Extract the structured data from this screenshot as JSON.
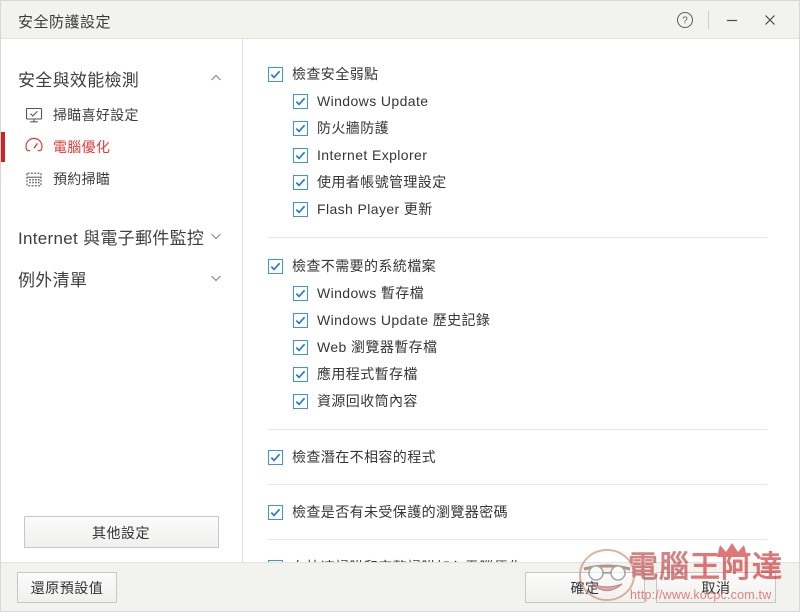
{
  "window": {
    "title": "安全防護設定",
    "controls": [
      {
        "name": "help-button",
        "glyph": "?"
      },
      {
        "name": "minimize-button",
        "glyph": "−"
      },
      {
        "name": "close-button",
        "glyph": "×"
      }
    ]
  },
  "sidebar": {
    "sections": [
      {
        "label": "安全與效能檢測",
        "expanded": true,
        "chevron": "chevron-up-icon",
        "items": [
          {
            "label": "掃瞄喜好設定",
            "icon": "monitor-check-icon",
            "active": false
          },
          {
            "label": "電腦優化",
            "icon": "gauge-icon",
            "active": true
          },
          {
            "label": "預約掃瞄",
            "icon": "calendar-icon",
            "active": false
          }
        ]
      },
      {
        "label": "Internet 與電子郵件監控",
        "expanded": false,
        "chevron": "chevron-down-icon",
        "items": []
      },
      {
        "label": "例外清單",
        "expanded": false,
        "chevron": "chevron-down-icon",
        "items": []
      }
    ],
    "other_settings_label": "其他設定"
  },
  "main": {
    "groups": [
      {
        "parent": {
          "label": "檢查安全弱點",
          "checked": true
        },
        "children": [
          {
            "label": "Windows Update",
            "checked": true
          },
          {
            "label": "防火牆防護",
            "checked": true
          },
          {
            "label": "Internet Explorer",
            "checked": true
          },
          {
            "label": "使用者帳號管理設定",
            "checked": true
          },
          {
            "label": "Flash Player 更新",
            "checked": true
          }
        ]
      },
      {
        "parent": {
          "label": "檢查不需要的系統檔案",
          "checked": true
        },
        "children": [
          {
            "label": "Windows 暫存檔",
            "checked": true
          },
          {
            "label": "Windows Update 歷史記錄",
            "checked": true
          },
          {
            "label": "Web 瀏覽器暫存檔",
            "checked": true
          },
          {
            "label": "應用程式暫存檔",
            "checked": true
          },
          {
            "label": "資源回收筒內容",
            "checked": true
          }
        ]
      },
      {
        "parent": {
          "label": "檢查潛在不相容的程式",
          "checked": true
        },
        "children": []
      },
      {
        "parent": {
          "label": "檢查是否有未受保護的瀏覽器密碼",
          "checked": true
        },
        "children": []
      },
      {
        "parent": {
          "label": "在快速掃瞄和完整掃瞄加入電腦優化",
          "checked": true
        },
        "children": []
      }
    ]
  },
  "footer": {
    "restore_label": "還原預設值",
    "ok_label": "確定",
    "cancel_label": "取消"
  },
  "watermark": {
    "text_part1": "電腦",
    "text_part2": "王阿達",
    "url": "http://www.kocpc.com.tw"
  },
  "colors": {
    "accent_red": "#cf2222",
    "checkbox_blue": "#3f95d2",
    "titlebar_bg": "#f2f2ef",
    "text": "#363636"
  }
}
